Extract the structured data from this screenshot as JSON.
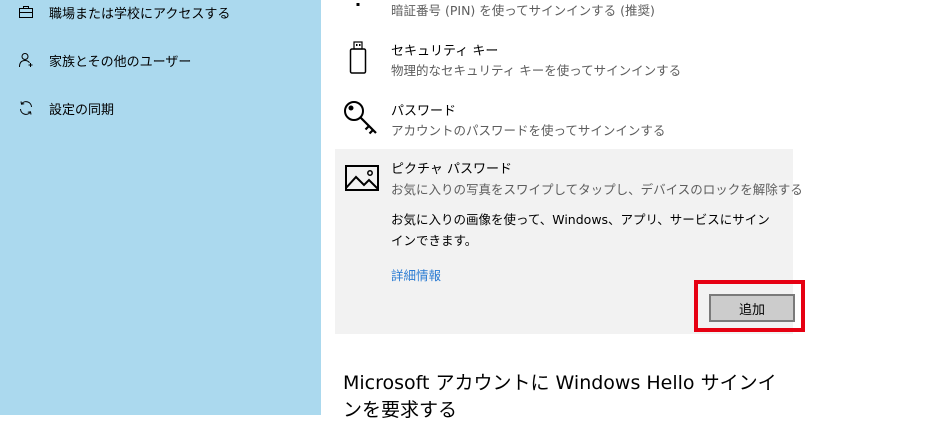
{
  "sidebar": {
    "items": [
      {
        "label": "職場または学校にアクセスする",
        "icon": "briefcase-icon"
      },
      {
        "label": "家族とその他のユーザー",
        "icon": "person-add-icon"
      },
      {
        "label": "設定の同期",
        "icon": "sync-icon"
      }
    ]
  },
  "signin_options": {
    "pin": {
      "desc": "暗証番号 (PIN) を使ってサインインする (推奨)",
      "icon": "keypad-icon"
    },
    "security_key": {
      "title": "セキュリティ キー",
      "desc": "物理的なセキュリティ キーを使ってサインインする",
      "icon": "usb-key-icon"
    },
    "password": {
      "title": "パスワード",
      "desc": "アカウントのパスワードを使ってサインインする",
      "icon": "key-icon"
    },
    "picture_password": {
      "title": "ピクチャ パスワード",
      "desc": "お気に入りの写真をスワイプしてタップし、デバイスのロックを解除する",
      "body": "お気に入りの画像を使って、Windows、アプリ、サービスにサインインできます。",
      "link": "詳細情報",
      "button": "追加",
      "icon": "picture-icon"
    }
  },
  "hello_heading": "Microsoft アカウントに Windows Hello サインインを要求する"
}
